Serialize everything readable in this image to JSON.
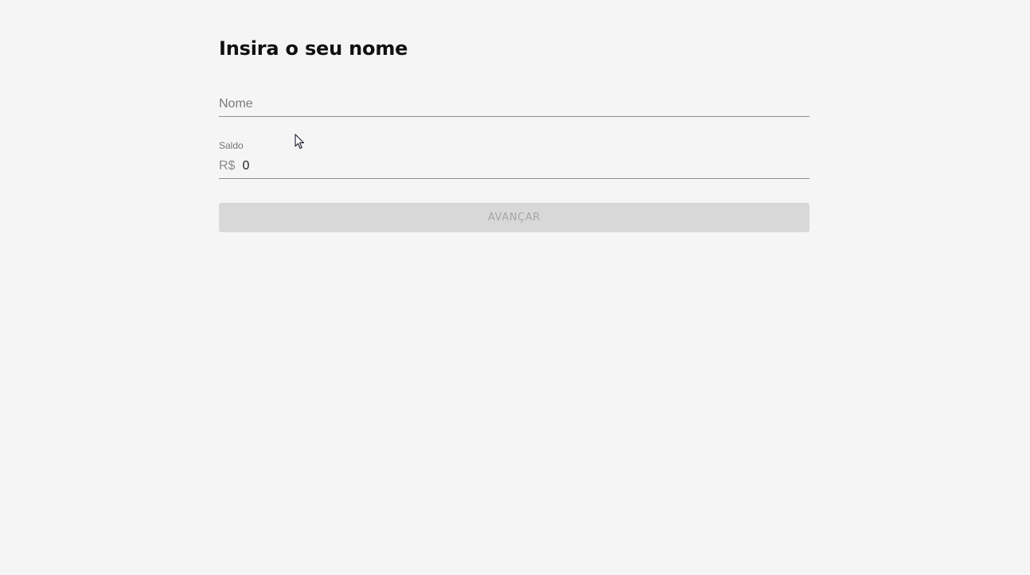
{
  "page": {
    "title": "Insira o seu nome"
  },
  "form": {
    "name_field": {
      "placeholder": "Nome",
      "value": ""
    },
    "balance_field": {
      "label": "Saldo",
      "prefix": "R$",
      "value": "0"
    },
    "submit_button": {
      "label": "AVANÇAR",
      "disabled": true
    }
  },
  "colors": {
    "background": "#f5f5f5",
    "title": "#111111",
    "underline": "#8f8f8f",
    "button_disabled_bg": "#d8d8d8",
    "button_disabled_text": "#a6a6a6"
  },
  "icons": {
    "mouse_cursor": "arrow-cursor-icon"
  }
}
